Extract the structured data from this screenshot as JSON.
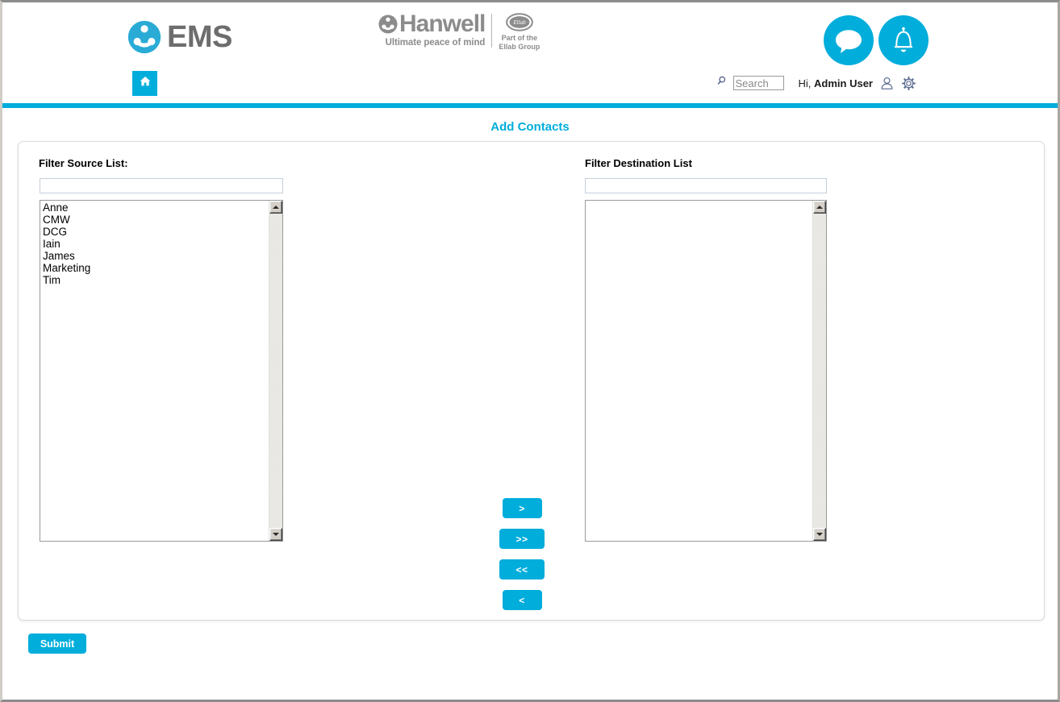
{
  "brand": {
    "ems_name": "EMS",
    "hanwell_name": "Hanwell",
    "hanwell_tagline": "Ultimate peace of mind",
    "ellab_badge_text": "Ellab",
    "ellab_line1": "Part of the",
    "ellab_line2": "Ellab Group",
    "accent_color": "#00ADDB",
    "logo_gray": "#6d6d6d"
  },
  "header": {
    "chat_icon": "chat-bubble-icon",
    "bell_icon": "bell-icon"
  },
  "nav": {
    "home_icon": "home-icon",
    "search_icon": "search-icon",
    "search_placeholder": "Search",
    "search_value": "",
    "greeting_prefix": "Hi,",
    "user_name": "Admin User",
    "user_icon": "user-icon",
    "settings_icon": "gear-icon"
  },
  "page": {
    "title": "Add Contacts"
  },
  "source": {
    "label": "Filter Source List:",
    "filter_value": "",
    "filter_placeholder": "",
    "items": [
      "Anne",
      "CMW",
      "DCG",
      "Iain",
      "James",
      "Marketing",
      "Tim"
    ]
  },
  "destination": {
    "label": "Filter Destination List",
    "filter_value": "",
    "filter_placeholder": "",
    "items": []
  },
  "transfer": {
    "move_right_label": ">",
    "move_all_right_label": ">>",
    "move_all_left_label": "<<",
    "move_left_label": "<"
  },
  "actions": {
    "submit_label": "Submit"
  }
}
